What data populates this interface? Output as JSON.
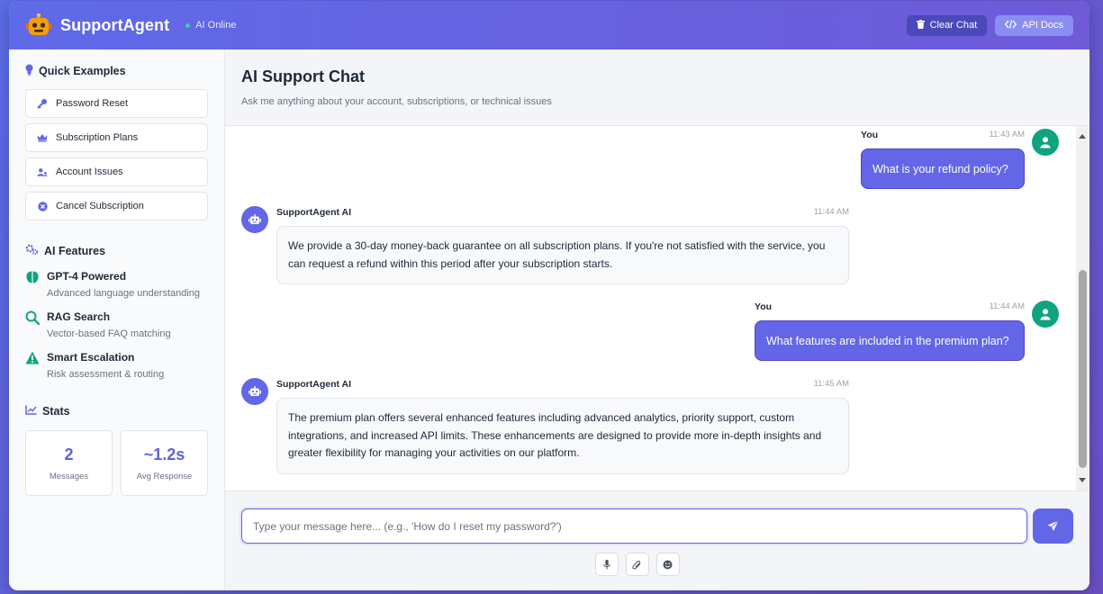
{
  "header": {
    "app_title": "SupportAgent",
    "status_text": "AI Online",
    "clear_chat_label": "Clear Chat",
    "api_docs_label": "API Docs"
  },
  "sidebar": {
    "quick_examples_title": "Quick Examples",
    "examples": [
      {
        "label": "Password Reset",
        "icon": "key-icon"
      },
      {
        "label": "Subscription Plans",
        "icon": "crown-icon"
      },
      {
        "label": "Account Issues",
        "icon": "users-icon"
      },
      {
        "label": "Cancel Subscription",
        "icon": "cancel-circle-icon"
      }
    ],
    "features_title": "AI Features",
    "features": [
      {
        "name": "GPT-4 Powered",
        "desc": "Advanced language understanding",
        "icon": "brain-icon"
      },
      {
        "name": "RAG Search",
        "desc": "Vector-based FAQ matching",
        "icon": "search-icon"
      },
      {
        "name": "Smart Escalation",
        "desc": "Risk assessment & routing",
        "icon": "warning-icon"
      }
    ],
    "stats_title": "Stats",
    "stats": [
      {
        "value": "2",
        "label": "Messages"
      },
      {
        "value": "~1.2s",
        "label": "Avg Response"
      }
    ]
  },
  "chat": {
    "title": "AI Support Chat",
    "subtitle": "Ask me anything about your account, subscriptions, or technical issues",
    "messages": [
      {
        "sender": "You",
        "time": "11:43 AM",
        "text": "What is your refund policy?"
      },
      {
        "sender": "SupportAgent AI",
        "time": "11:44 AM",
        "text": "We provide a 30-day money-back guarantee on all subscription plans. If you're not satisfied with the service, you can request a refund within this period after your subscription starts."
      },
      {
        "sender": "You",
        "time": "11:44 AM",
        "text": "What features are included in the premium plan?"
      },
      {
        "sender": "SupportAgent AI",
        "time": "11:45 AM",
        "text": "The premium plan offers several enhanced features including advanced analytics, priority support, custom integrations, and increased API limits. These enhancements are designed to provide more in-depth insights and greater flexibility for managing your activities on our platform."
      }
    ],
    "input_placeholder": "Type your message here... (e.g., 'How do I reset my password?')",
    "input_value": ""
  },
  "colors": {
    "accent": "#6366e6",
    "user_avatar": "#10a37f",
    "online": "#34d399"
  }
}
